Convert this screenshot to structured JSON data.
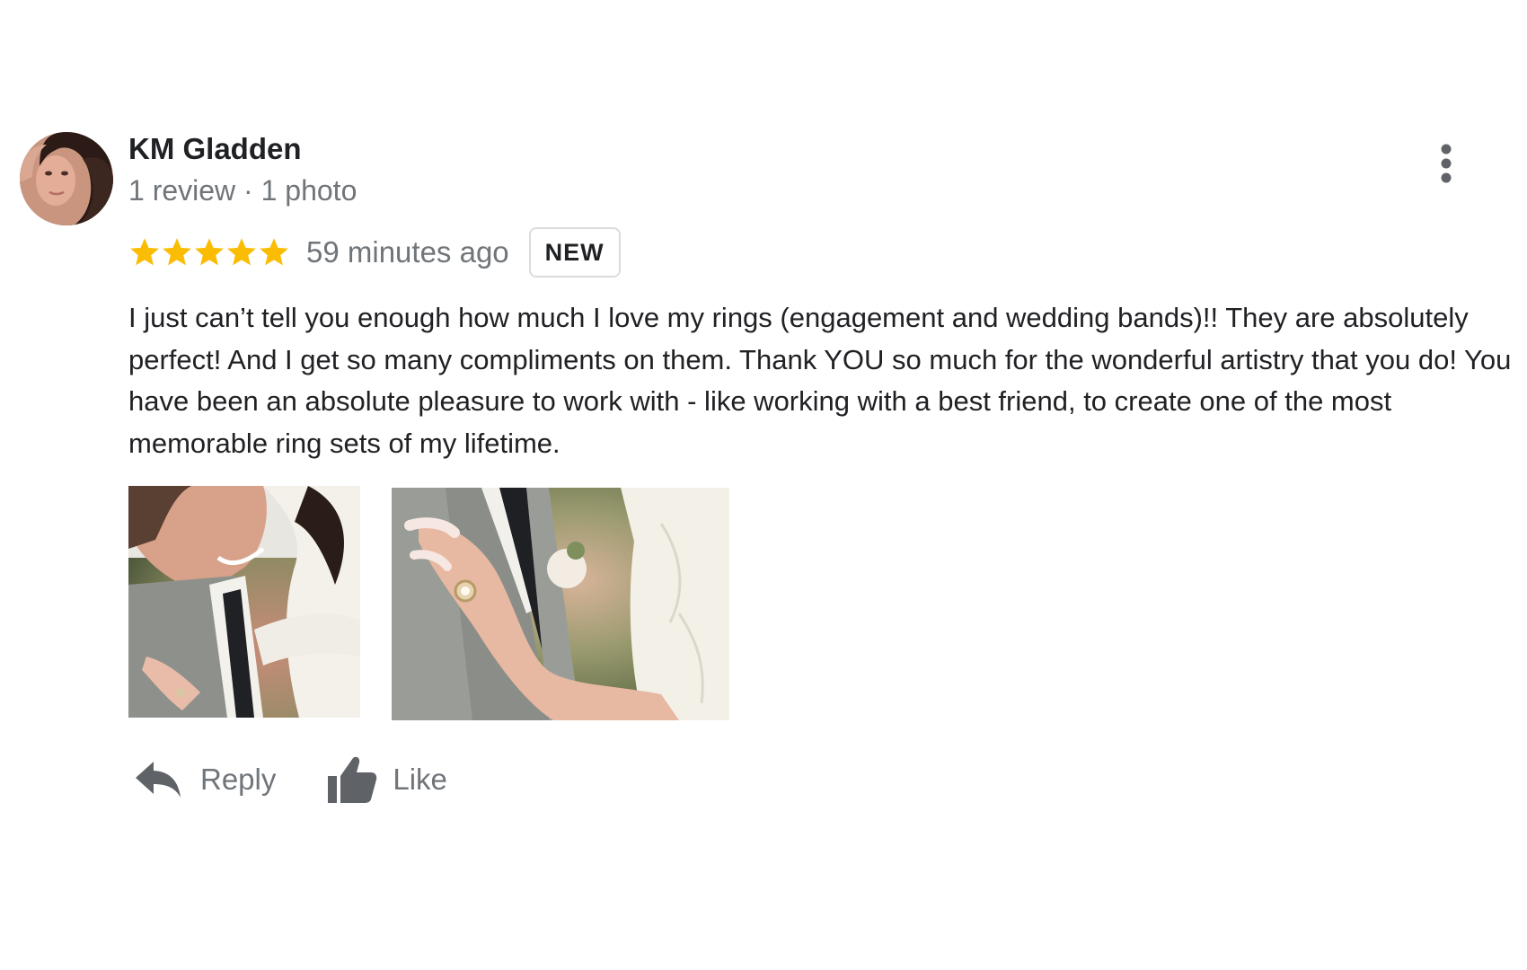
{
  "author": {
    "name": "KM Gladden",
    "meta": "1 review · 1 photo"
  },
  "rating": {
    "stars": 5,
    "max_stars": 5,
    "time_ago": "59 minutes ago",
    "badge": "NEW"
  },
  "review": {
    "text": "I just can’t tell you enough how much I love my rings (engagement and wedding bands)!! They are absolutely perfect! And I get so many compliments on them. Thank YOU so much for the wonderful artistry that you do! You have been an absolute pleasure to work with - like working with a best friend, to create one of the most memorable ring sets of my lifetime."
  },
  "photos": [
    {
      "icon": "review-photo-couple"
    },
    {
      "icon": "review-photo-ring-hand"
    }
  ],
  "actions": {
    "reply_label": "Reply",
    "like_label": "Like"
  },
  "icons": {
    "more": "more-vert-icon",
    "star": "star-icon",
    "reply": "reply-icon",
    "like": "thumbs-up-icon"
  },
  "colors": {
    "star": "#fbbc04",
    "secondary_text": "#70757a",
    "primary_text": "#202124",
    "icon": "#5f6368",
    "badge_border": "#dadce0"
  }
}
